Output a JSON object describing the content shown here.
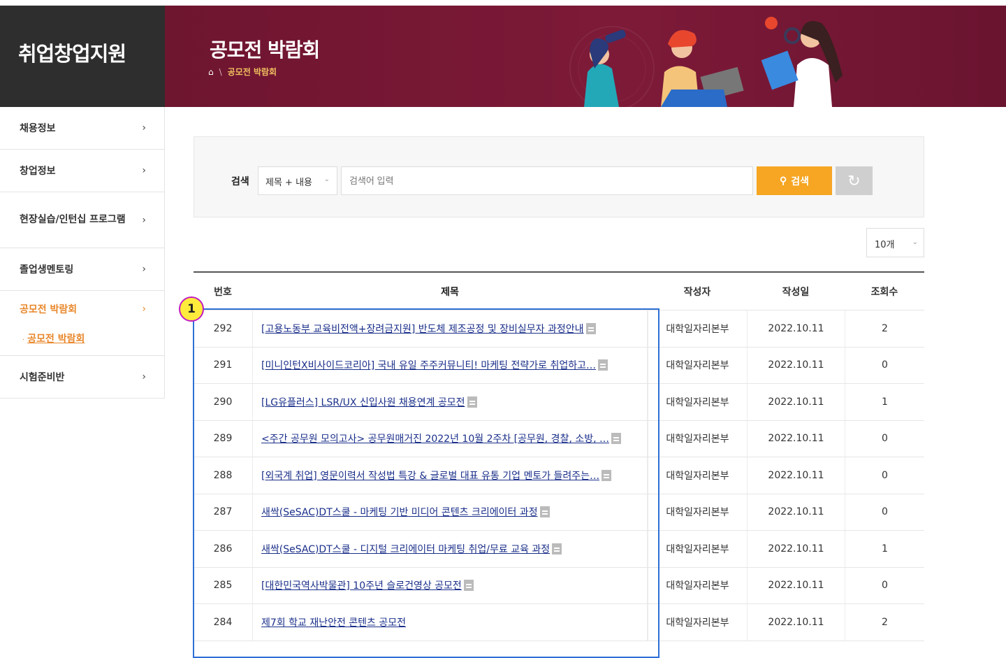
{
  "sidebar": {
    "title": "취업창업지원",
    "items": [
      {
        "label": "채용정보",
        "chev": "›"
      },
      {
        "label": "창업정보",
        "chev": "›"
      },
      {
        "label": "현장실습/인턴십 프로그램",
        "chev": "›"
      },
      {
        "label": "졸업생멘토링",
        "chev": "›"
      },
      {
        "label": "공모전 박람회",
        "chev": "›"
      },
      {
        "label": "시험준비반",
        "chev": "›"
      }
    ],
    "sub_item": "공모전 박람회"
  },
  "banner": {
    "title": "공모전 박람회",
    "breadcrumb_current": "공모전 박람회",
    "breadcrumb_sep": "\\",
    "home_icon": "⌂"
  },
  "search": {
    "label": "검색",
    "select_value": "제목 + 내용",
    "placeholder": "검색어 입력",
    "button_label": "검색",
    "search_icon": "⚲",
    "reset_icon": "↻"
  },
  "page_size": "10개",
  "table": {
    "headers": {
      "num": "번호",
      "title": "제목",
      "author": "작성자",
      "date": "작성일",
      "views": "조회수"
    },
    "rows": [
      {
        "num": "292",
        "title": "[고용노동부 교육비전액+장려금지원] 반도체 제조공정 및 장비실무자 과정안내",
        "author": "대학일자리본부",
        "date": "2022.10.11",
        "views": "2",
        "attach": true
      },
      {
        "num": "291",
        "title": "[미니인턴X비사이드코리아] 국내 유일 주주커뮤니티! 마케팅 전략가로 취업하고…",
        "author": "대학일자리본부",
        "date": "2022.10.11",
        "views": "0",
        "attach": true
      },
      {
        "num": "290",
        "title": "[LG유플러스] LSR/UX 신입사원 채용연계 공모전",
        "author": "대학일자리본부",
        "date": "2022.10.11",
        "views": "1",
        "attach": true
      },
      {
        "num": "289",
        "title": "<주간 공무원 모의고사> 공무원매거진 2022년 10월 2주차 [공무원, 경찰, 소방, …",
        "author": "대학일자리본부",
        "date": "2022.10.11",
        "views": "0",
        "attach": true
      },
      {
        "num": "288",
        "title": "[외국계 취업] 영문이력서 작성법 특강 & 글로벌 대표 유통 기업 멘토가 들려주는…",
        "author": "대학일자리본부",
        "date": "2022.10.11",
        "views": "0",
        "attach": true
      },
      {
        "num": "287",
        "title": "새싹(SeSAC)DT스쿨 - 마케팅 기반 미디어 콘텐츠 크리에이터 과정",
        "author": "대학일자리본부",
        "date": "2022.10.11",
        "views": "0",
        "attach": true
      },
      {
        "num": "286",
        "title": "새싹(SeSAC)DT스쿨 - 디지털 크리에이터 마케팅 취업/무료 교육 과정",
        "author": "대학일자리본부",
        "date": "2022.10.11",
        "views": "1",
        "attach": true
      },
      {
        "num": "285",
        "title": "[대한민국역사박물관] 10주년 슬로건영상 공모전",
        "author": "대학일자리본부",
        "date": "2022.10.11",
        "views": "0",
        "attach": true
      },
      {
        "num": "284",
        "title": "제7회 학교 재난안전 콘텐츠 공모전",
        "author": "대학일자리본부",
        "date": "2022.10.11",
        "views": "2",
        "attach": false
      }
    ]
  },
  "annotation": {
    "badge": "1"
  },
  "colors": {
    "accent": "#f6a623",
    "banner": "#7d1a38",
    "active": "#e8872a",
    "link": "#1a2f8a",
    "annotation": "#2d6fd6"
  }
}
